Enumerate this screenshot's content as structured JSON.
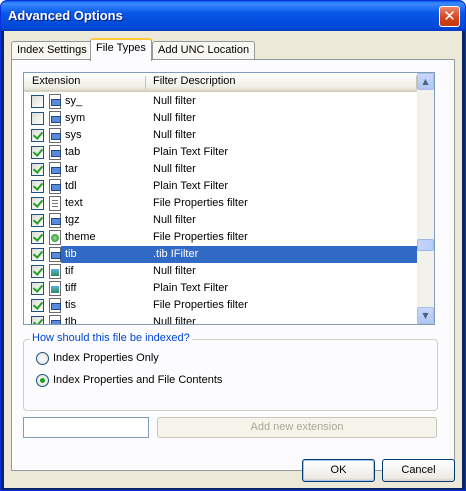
{
  "window": {
    "title": "Advanced Options",
    "close_glyph": "✕"
  },
  "tabs": [
    {
      "label": "Index Settings",
      "active": false
    },
    {
      "label": "File Types",
      "active": true
    },
    {
      "label": "Add UNC Location",
      "active": false
    }
  ],
  "list": {
    "columns": [
      "Extension",
      "Filter Description"
    ],
    "rows": [
      {
        "ext": "sy_",
        "desc": "Null filter",
        "checked": false,
        "icon": "dll-file-icon"
      },
      {
        "ext": "sym",
        "desc": "Null filter",
        "checked": false,
        "icon": "dll-file-icon"
      },
      {
        "ext": "sys",
        "desc": "Null filter",
        "checked": true,
        "icon": "dll-file-icon"
      },
      {
        "ext": "tab",
        "desc": "Plain Text Filter",
        "checked": true,
        "icon": "dll-file-icon"
      },
      {
        "ext": "tar",
        "desc": "Null filter",
        "checked": true,
        "icon": "dll-file-icon"
      },
      {
        "ext": "tdl",
        "desc": "Plain Text Filter",
        "checked": true,
        "icon": "dll-file-icon"
      },
      {
        "ext": "text",
        "desc": "File Properties filter",
        "checked": true,
        "icon": "text-file-icon"
      },
      {
        "ext": "tgz",
        "desc": "Null filter",
        "checked": true,
        "icon": "dll-file-icon"
      },
      {
        "ext": "theme",
        "desc": "File Properties filter",
        "checked": true,
        "icon": "theme-file-icon"
      },
      {
        "ext": "tib",
        "desc": ".tib IFilter",
        "checked": true,
        "icon": "dll-file-icon",
        "selected": true
      },
      {
        "ext": "tif",
        "desc": "Null filter",
        "checked": true,
        "icon": "image-file-icon"
      },
      {
        "ext": "tiff",
        "desc": "Plain Text Filter",
        "checked": true,
        "icon": "image-file-icon"
      },
      {
        "ext": "tis",
        "desc": "File Properties filter",
        "checked": true,
        "icon": "dll-file-icon"
      },
      {
        "ext": "tlb",
        "desc": "Null filter",
        "checked": true,
        "icon": "dll-file-icon"
      }
    ]
  },
  "index_group": {
    "legend": "How should this file be indexed?",
    "options": [
      {
        "label": "Index Properties Only",
        "selected": false
      },
      {
        "label": "Index Properties and File Contents",
        "selected": true
      }
    ]
  },
  "extension_input": {
    "value": ""
  },
  "add_extension_label": "Add new extension",
  "buttons": {
    "ok": "OK",
    "cancel": "Cancel"
  },
  "colors": {
    "titlebar": "#0054e3",
    "selection": "#316ac5",
    "accent_tab": "#ffc83c",
    "group_legend": "#0046d5"
  }
}
